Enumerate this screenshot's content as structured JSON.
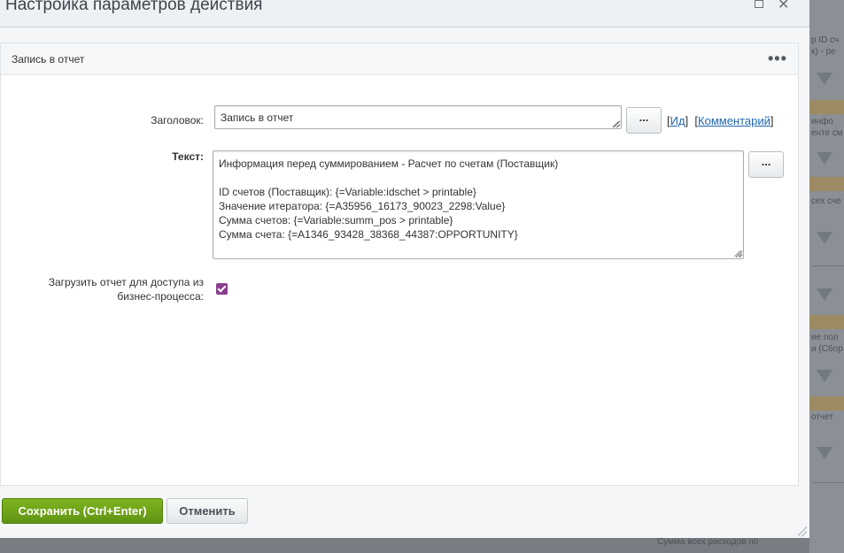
{
  "dialog": {
    "title": "Настройка параметров действия",
    "maximize_icon": "maximize-icon",
    "close_icon": "close-icon",
    "close_glyph": "✕"
  },
  "panel": {
    "title": "Запись в отчет",
    "menu_glyph": "•••",
    "menu_icon": "more-icon"
  },
  "form": {
    "heading_label": "Заголовок:",
    "heading_value": "Запись в отчет",
    "dots_label": "...",
    "id_link": "Ид",
    "comment_link": "Комментарий",
    "text_label": "Текст:",
    "text_value": "Информация перед суммированием - Расчет по счетам (Поставщик)\n\nID счетов (Поставщик): {=Variable:idschet > printable}\nЗначение итератора: {=A35956_16173_90023_2298:Value}\nСумма счетов: {=Variable:summ_pos > printable}\nСумма счета: {=A1346_93428_38368_44387:OPPORTUNITY}",
    "upload_label_line1": "Загрузить отчет для доступа из",
    "upload_label_line2": "бизнес-процесса:",
    "upload_checked": true
  },
  "buttons": {
    "save": "Сохранить (Ctrl+Enter)",
    "cancel": "Отменить"
  },
  "colors": {
    "save_button": "#6ca41a",
    "checkbox": "#8b3e8f",
    "link": "#2067b0"
  }
}
